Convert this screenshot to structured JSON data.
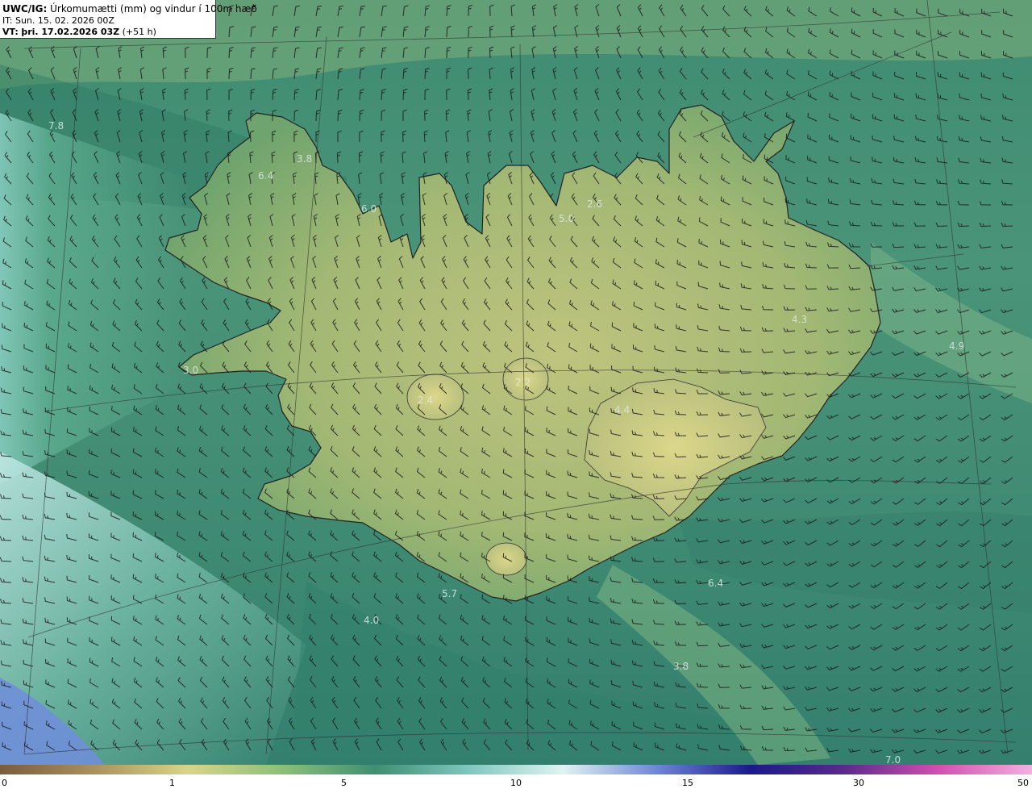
{
  "header": {
    "product": "UWC/IG:",
    "title": "Úrkomumætti (mm) og vindur í 100m hæð",
    "init_line": "IT: Sun. 15. 02. 2026 00Z",
    "valid_prefix": "VT:",
    "valid_time": "þri. 17.02.2026 03Z",
    "lead": "(+51 h)"
  },
  "map": {
    "value_labels": [
      {
        "text": "7.8"
      },
      {
        "text": "3.8"
      },
      {
        "text": "6.4"
      },
      {
        "text": "6.0"
      },
      {
        "text": "2.6"
      },
      {
        "text": "5.0"
      },
      {
        "text": "4.3"
      },
      {
        "text": "4.9"
      },
      {
        "text": "3.0"
      },
      {
        "text": "2.4"
      },
      {
        "text": "2.2"
      },
      {
        "text": "4.4"
      },
      {
        "text": "5.7"
      },
      {
        "text": "4.0"
      },
      {
        "text": "6.4"
      },
      {
        "text": "3.8"
      },
      {
        "text": "7.0"
      }
    ]
  },
  "colorbar": {
    "ticks": [
      "0",
      "1",
      "5",
      "10",
      "15",
      "30",
      "50"
    ],
    "colors": [
      "#7a5c3a",
      "#a8925c",
      "#d8d58a",
      "#8cc07a",
      "#3f8f72",
      "#7fc7bf",
      "#dff4f2",
      "#6f86d6",
      "#1a1a8a",
      "#5a2a8a",
      "#d24fb0",
      "#f4b0e0"
    ]
  }
}
